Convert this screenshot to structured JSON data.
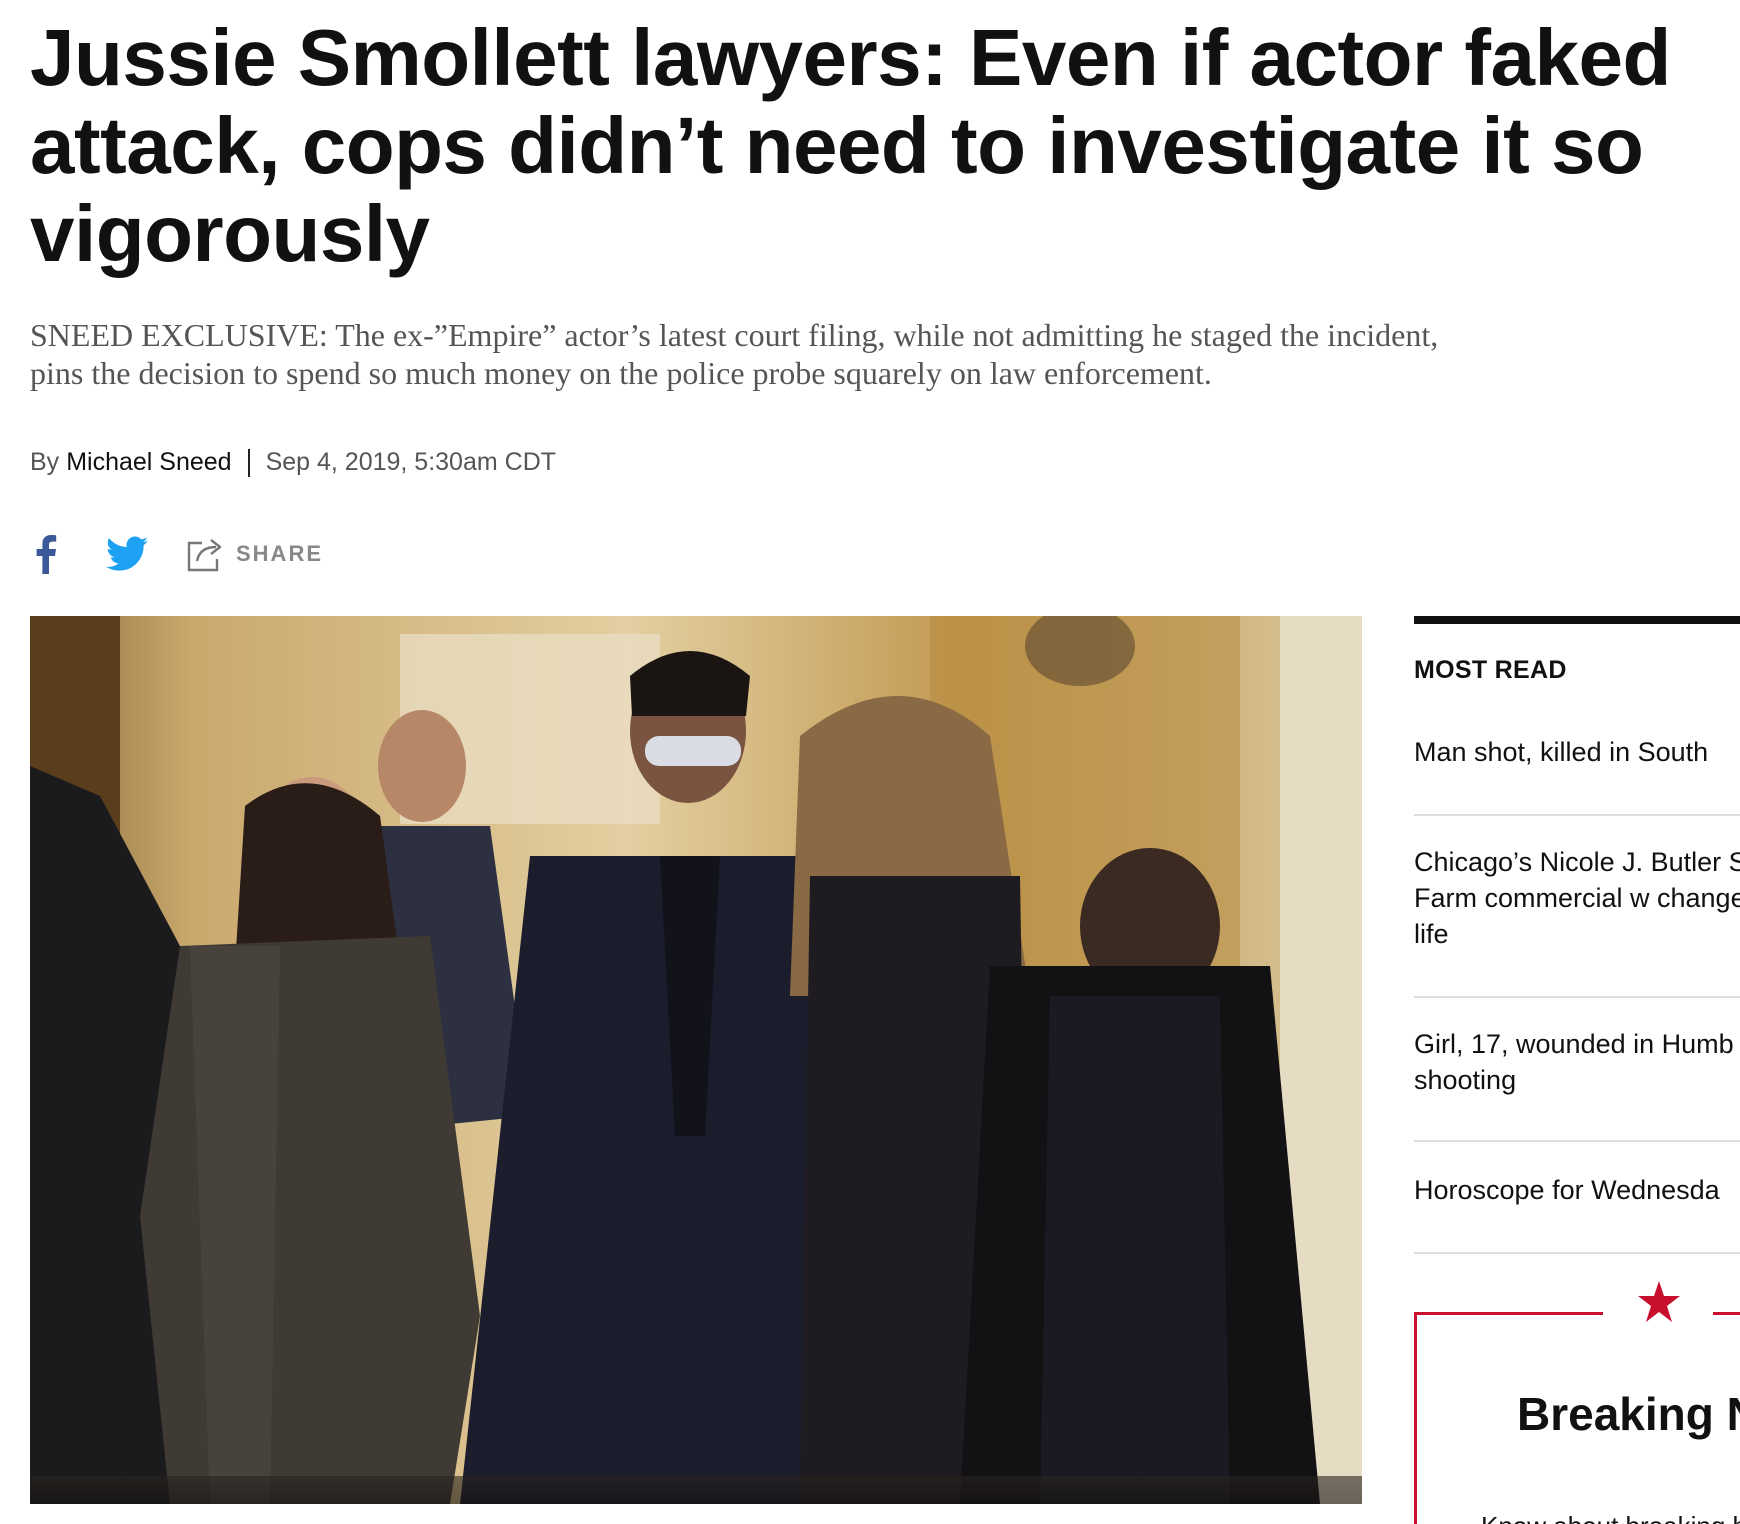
{
  "article": {
    "headline": "Jussie Smollett lawyers: Even if actor faked attack, cops didn’t need to investigate it so vigorously",
    "dek": "SNEED EXCLUSIVE: The ex-”Empire” actor’s latest court filing, while not admitting he staged the incident, pins the decision to spend so much money on the police probe squarely on law enforcement.",
    "byline_prefix": "By",
    "author": "Michael Sneed",
    "date": "Sep 4, 2019, 5:30am CDT"
  },
  "share": {
    "facebook_icon": "facebook-icon",
    "twitter_icon": "twitter-icon",
    "share_icon": "share-icon",
    "share_label": "SHARE",
    "facebook_color": "#3b5998",
    "twitter_color": "#1da1f2"
  },
  "sidebar": {
    "most_read_title": "MOST READ",
    "items": [
      "Man shot, killed in South",
      "Chicago’s Nicole J. Butler State Farm commercial w changed her life",
      "Girl, 17, wounded in Humb shooting",
      "Horoscope for Wednesda"
    ],
    "breaking": {
      "icon": "star-icon",
      "title": "Breaking N",
      "text": "Know about breaking happens. We follow th",
      "accent_color": "#c8102e"
    }
  }
}
